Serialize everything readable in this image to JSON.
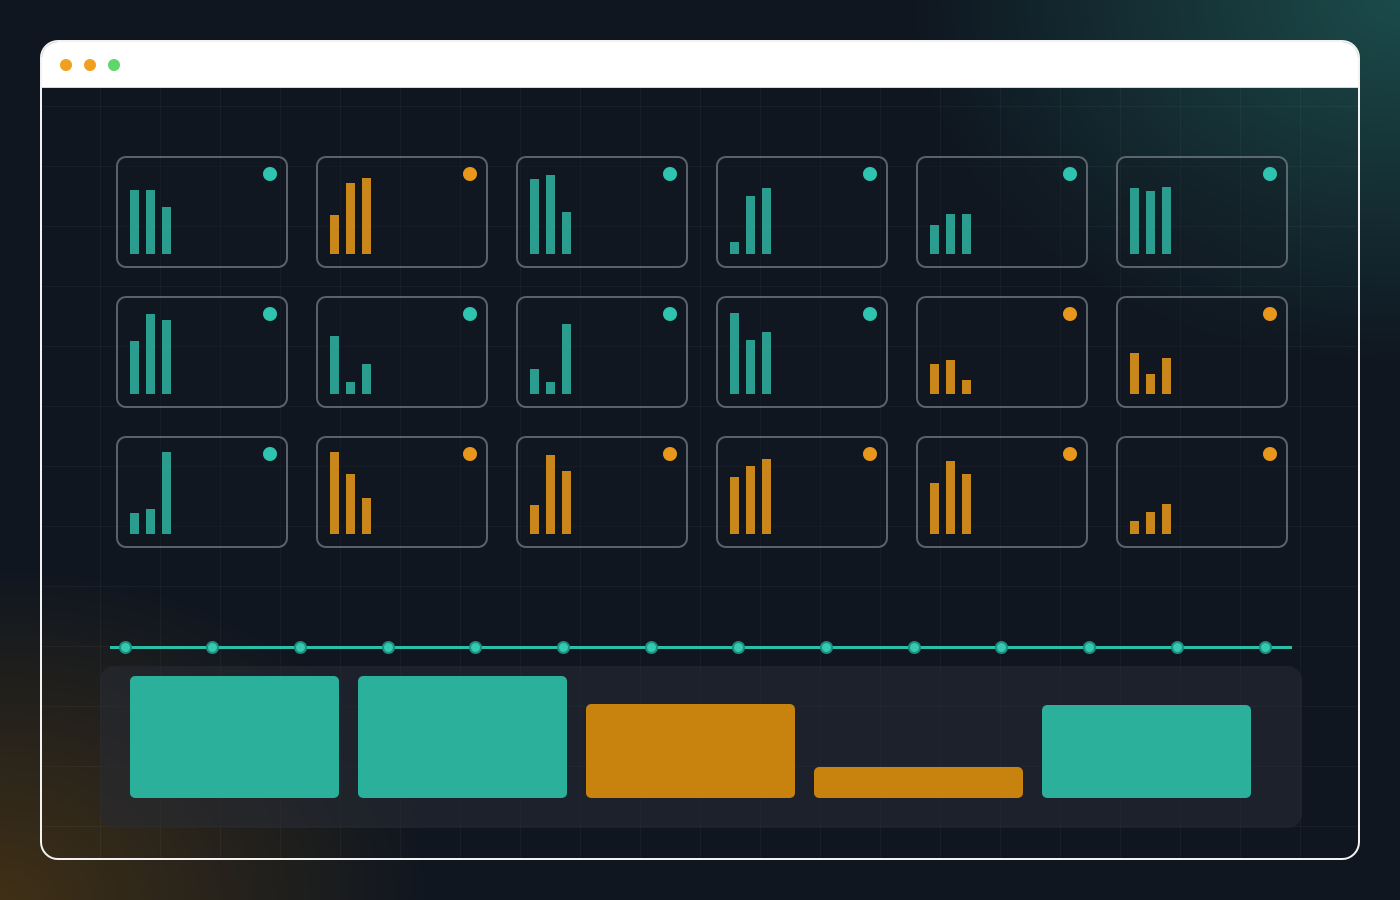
{
  "colors": {
    "teal": "#2a9d8f",
    "orange": "#c9861a",
    "teal_dot": "#2ec4b0",
    "orange_dot": "#e8961c",
    "teal_block": "#2bb09c",
    "orange_block": "#c8820e"
  },
  "window_controls": [
    {
      "name": "close",
      "color": "#f0a020"
    },
    {
      "name": "minimize",
      "color": "#f0a020"
    },
    {
      "name": "maximize",
      "color": "#5ed66a"
    }
  ],
  "cards": [
    {
      "status": "teal",
      "bars": [
        0.78,
        0.78,
        0.57
      ]
    },
    {
      "status": "orange",
      "bars": [
        0.47,
        0.87,
        0.93
      ]
    },
    {
      "status": "teal",
      "bars": [
        0.92,
        0.96,
        0.51
      ]
    },
    {
      "status": "teal",
      "bars": [
        0.15,
        0.71,
        0.8
      ]
    },
    {
      "status": "teal",
      "bars": [
        0.35,
        0.49,
        0.49
      ]
    },
    {
      "status": "teal",
      "bars": [
        0.81,
        0.77,
        0.82
      ]
    },
    {
      "status": "teal",
      "bars": [
        0.65,
        0.98,
        0.9
      ]
    },
    {
      "status": "teal",
      "bars": [
        0.71,
        0.15,
        0.37
      ]
    },
    {
      "status": "teal",
      "bars": [
        0.31,
        0.15,
        0.85
      ]
    },
    {
      "status": "teal",
      "bars": [
        0.99,
        0.66,
        0.76
      ]
    },
    {
      "status": "orange",
      "bars": [
        0.37,
        0.41,
        0.17
      ]
    },
    {
      "status": "orange",
      "bars": [
        0.5,
        0.24,
        0.44
      ]
    },
    {
      "status": "teal",
      "bars": [
        0.25,
        0.31,
        1.0
      ]
    },
    {
      "status": "orange",
      "bars": [
        1.0,
        0.73,
        0.44
      ]
    },
    {
      "status": "orange",
      "bars": [
        0.35,
        0.96,
        0.77
      ]
    },
    {
      "status": "orange",
      "bars": [
        0.7,
        0.83,
        0.92
      ]
    },
    {
      "status": "orange",
      "bars": [
        0.62,
        0.89,
        0.73
      ]
    },
    {
      "status": "orange",
      "bars": [
        0.16,
        0.27,
        0.37
      ]
    }
  ],
  "timeline": {
    "node_count": 14
  },
  "blocks": [
    {
      "status": "teal",
      "level": 1.0
    },
    {
      "status": "teal",
      "level": 1.0
    },
    {
      "status": "orange",
      "level": 0.77
    },
    {
      "status": "orange",
      "level": 0.25
    },
    {
      "status": "teal",
      "level": 0.76
    }
  ]
}
